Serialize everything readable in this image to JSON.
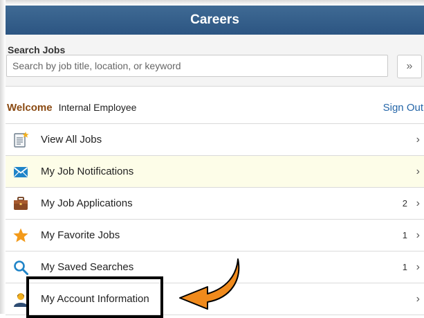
{
  "header": {
    "title": "Careers"
  },
  "search": {
    "label": "Search Jobs",
    "placeholder": "Search by job title, location, or keyword",
    "value": "",
    "button_label": "»"
  },
  "welcome": {
    "greeting": "Welcome",
    "user": "Internal Employee",
    "sign_out": "Sign Out"
  },
  "menu": {
    "items": [
      {
        "label": "View All Jobs",
        "count": "",
        "icon": "document-star-icon"
      },
      {
        "label": "My Job Notifications",
        "count": "",
        "icon": "envelope-icon"
      },
      {
        "label": "My Job Applications",
        "count": "2",
        "icon": "briefcase-icon"
      },
      {
        "label": "My Favorite Jobs",
        "count": "1",
        "icon": "star-icon"
      },
      {
        "label": "My Saved Searches",
        "count": "1",
        "icon": "magnifier-icon"
      },
      {
        "label": "My Account Information",
        "count": "",
        "icon": "user-account-icon"
      }
    ],
    "chevron": "›"
  },
  "colors": {
    "header": "#2f5a86",
    "welcome": "#8a4a12",
    "link": "#2566a8",
    "highlight_row": "#fdfde8",
    "arrow": "#f08a1c"
  }
}
